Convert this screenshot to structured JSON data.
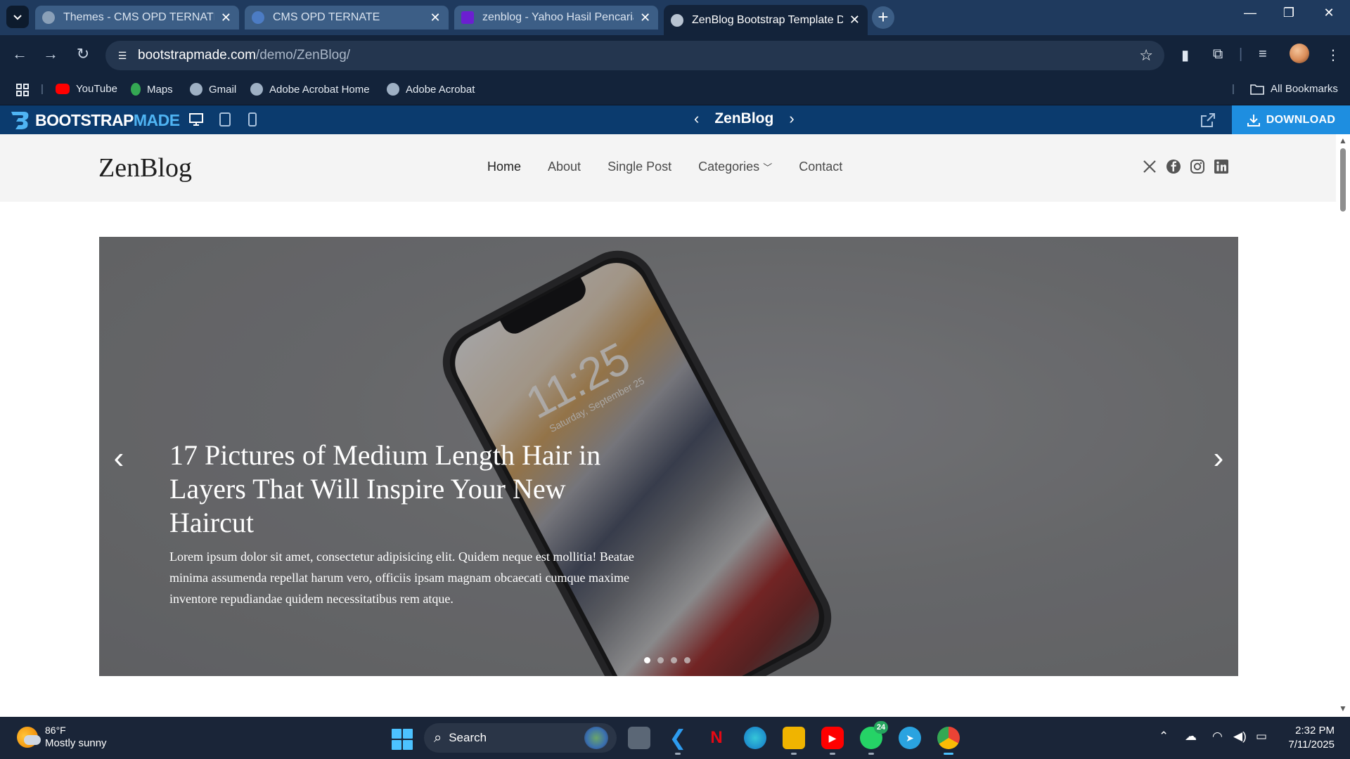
{
  "browser": {
    "tabs": [
      {
        "title": "Themes - CMS OPD TERNATE",
        "favicon": "globe-icon",
        "active": false
      },
      {
        "title": "CMS OPD TERNATE",
        "favicon": "site-logo-icon",
        "active": false
      },
      {
        "title": "zenblog - Yahoo Hasil Pencarian",
        "favicon": "yahoo-icon",
        "active": false
      },
      {
        "title": "ZenBlog Bootstrap Template De",
        "favicon": "globe-icon",
        "active": true
      }
    ],
    "url_host": "bootstrapmade.com",
    "url_path": "/demo/ZenBlog/",
    "bookmarks": [
      {
        "label": "YouTube",
        "icon": "youtube-icon"
      },
      {
        "label": "Maps",
        "icon": "maps-icon"
      },
      {
        "label": "Gmail",
        "icon": "globe-icon"
      },
      {
        "label": "Adobe Acrobat Home",
        "icon": "globe-icon"
      },
      {
        "label": "Adobe Acrobat",
        "icon": "globe-icon"
      }
    ],
    "all_bookmarks": "All Bookmarks"
  },
  "bootstrapmade": {
    "logo_part1": "BOOTSTRAP",
    "logo_part2": "MADE",
    "template_name": "ZenBlog",
    "download_label": "DOWNLOAD"
  },
  "site": {
    "logo": "ZenBlog",
    "nav": [
      "Home",
      "About",
      "Single Post",
      "Categories",
      "Contact"
    ],
    "socials": [
      "x-icon",
      "facebook-icon",
      "instagram-icon",
      "linkedin-icon"
    ]
  },
  "hero": {
    "title": "17 Pictures of Medium Length Hair in Layers That Will Inspire Your New Haircut",
    "text": "Lorem ipsum dolor sit amet, consectetur adipisicing elit. Quidem neque est mollitia! Beatae minima assumenda repellat harum vero, officiis ipsam magnam obcaecati cumque maxime inventore repudiandae quidem necessitatibus rem atque.",
    "phone_time": "11:25",
    "phone_date": "Saturday, September 25",
    "slides": 4,
    "active_slide": 0
  },
  "taskbar": {
    "weather_temp": "86°F",
    "weather_desc": "Mostly sunny",
    "search_label": "Search",
    "whatsapp_badge": "24",
    "time": "2:32 PM",
    "date": "7/11/2025"
  },
  "colors": {
    "tab_strip": "#1f3a5e",
    "toolbar": "#13233a",
    "bootstrapmade_bar": "#0b3b6e",
    "download_button": "#1e8ee0",
    "site_header": "#f4f4f4"
  }
}
